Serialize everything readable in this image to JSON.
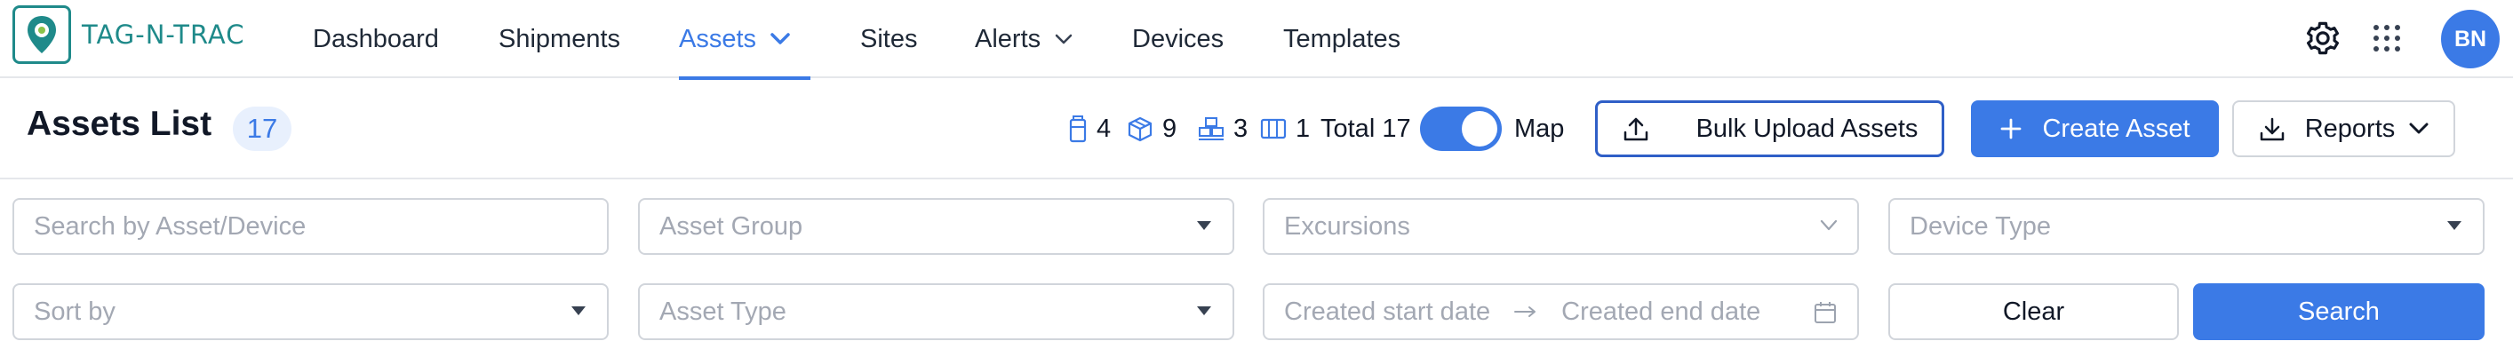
{
  "brand": {
    "logo_text": "TAG-N-TRAC",
    "accent": "#3b7ae6",
    "teal": "#1f8a8a"
  },
  "nav": {
    "dashboard": "Dashboard",
    "shipments": "Shipments",
    "assets": "Assets",
    "sites": "Sites",
    "alerts": "Alerts",
    "devices": "Devices",
    "templates": "Templates"
  },
  "user": {
    "initials": "BN"
  },
  "header": {
    "title": "Assets List",
    "count": "17",
    "stats": {
      "type1": "4",
      "type2": "9",
      "type3": "3",
      "type4": "1",
      "total_label": "Total 17"
    },
    "map_label": "Map",
    "map_toggle_on": true,
    "bulk_upload_label": "Bulk Upload Assets",
    "create_label": "Create Asset",
    "reports_label": "Reports"
  },
  "filters": {
    "search_placeholder": "Search by Asset/Device",
    "asset_group": "Asset Group",
    "excursions": "Excursions",
    "device_type": "Device Type",
    "sort_by": "Sort by",
    "asset_type": "Asset Type",
    "start_date": "Created start date",
    "end_date": "Created end date",
    "clear_label": "Clear",
    "search_label": "Search"
  }
}
